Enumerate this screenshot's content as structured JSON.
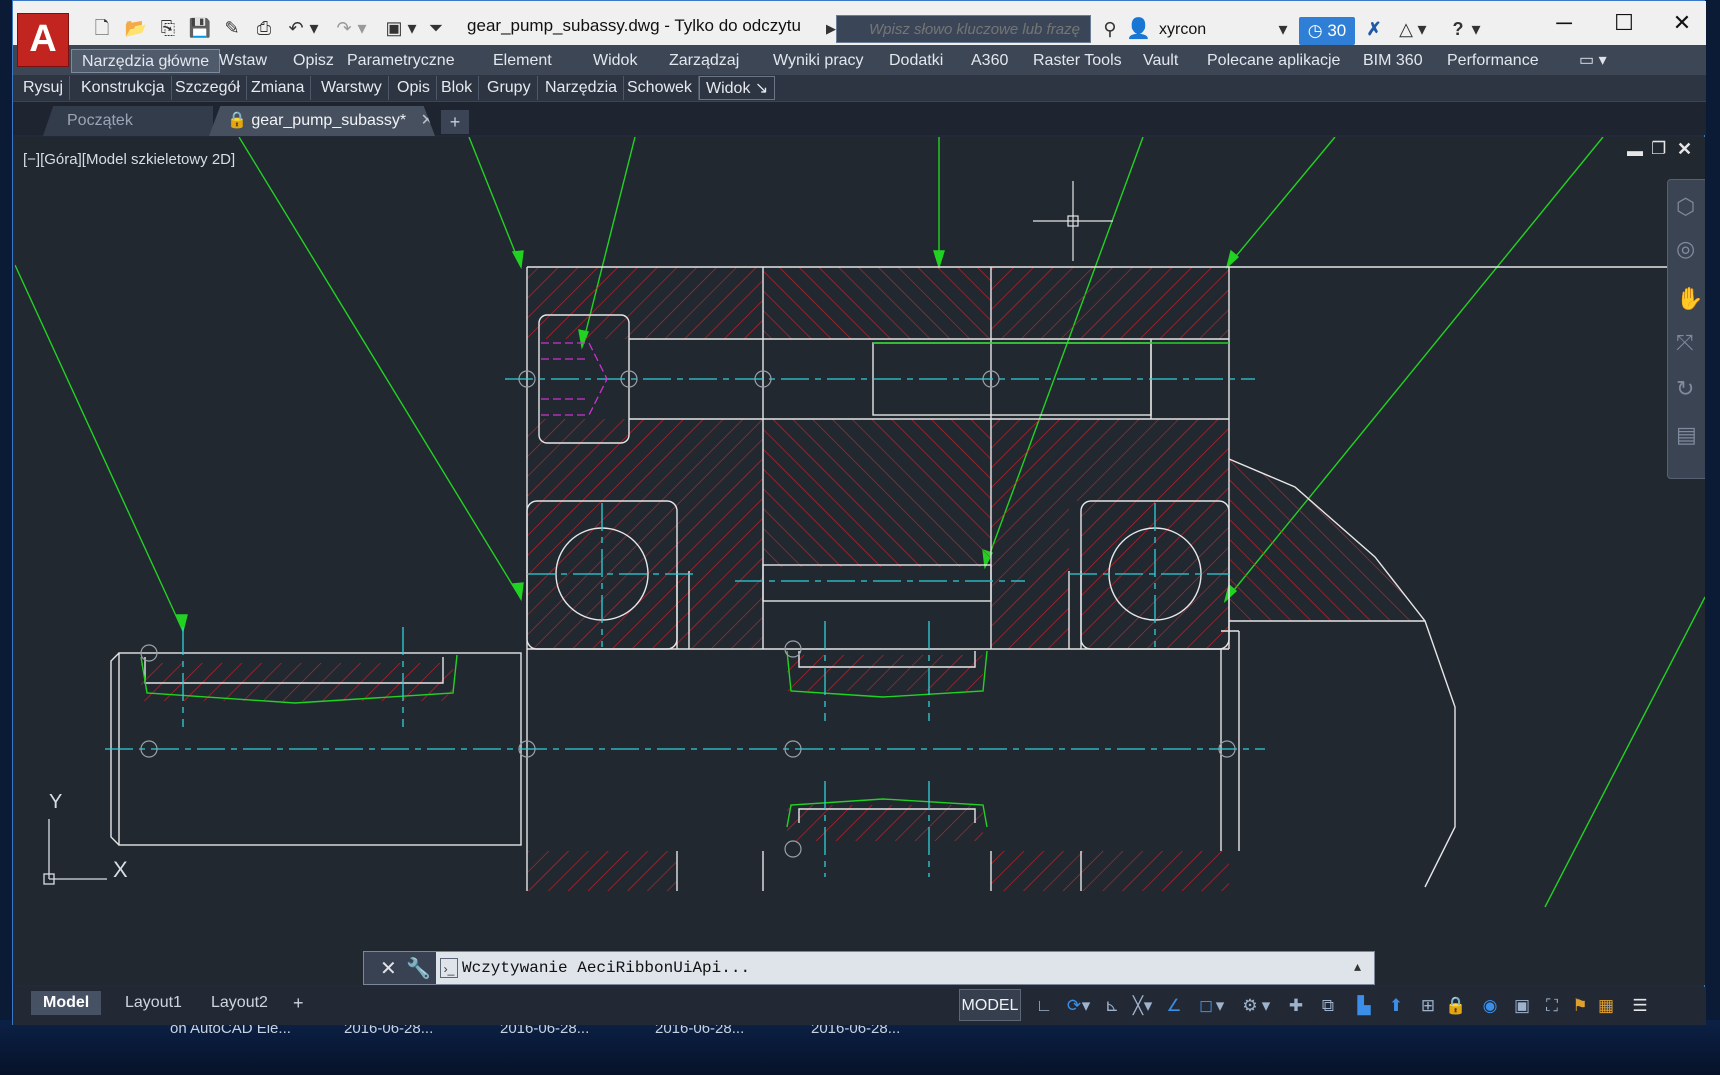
{
  "app": {
    "logo_letter": "A",
    "document_title": "gear_pump_subassy.dwg - Tylko do odczytu",
    "search_placeholder": "Wpisz słowo kluczowe lub frazę",
    "user_name": "xyrcon",
    "timer_count": "30"
  },
  "ribbon_tabs": [
    "Narzędzia główne",
    "Wstaw",
    "Opisz",
    "Parametryczne",
    "Element",
    "Widok",
    "Zarządzaj",
    "Wyniki pracy",
    "Dodatki",
    "A360",
    "Raster Tools",
    "Vault",
    "Polecane aplikacje",
    "BIM 360",
    "Performance"
  ],
  "ribbon_active": "Narzędzia główne",
  "panels": [
    "Rysuj",
    "Konstrukcja",
    "Szczegół",
    "Zmiana",
    "Warstwy",
    "Opis",
    "Blok",
    "Grupy",
    "Narzędzia",
    "Schowek",
    "Widok ↘"
  ],
  "file_tabs": [
    {
      "label": "Początek"
    },
    {
      "label": "gear_pump_subassy*"
    }
  ],
  "viewport": {
    "label": "[−][Góra][Model szkieletowy 2D]",
    "ucs_x": "X",
    "ucs_y": "Y"
  },
  "command_line": {
    "text": "Wczytywanie AeciRibbonUiApi..."
  },
  "layout_tabs": [
    "Model",
    "Layout1",
    "Layout2"
  ],
  "status": {
    "model_label": "MODEL"
  },
  "desktop": {
    "items": [
      "on AutoCAD Ele...",
      "2016-06-28...",
      "2016-06-28...",
      "2016-06-28...",
      "2016-06-28..."
    ]
  },
  "colors": {
    "hatch": "#d2222a",
    "centerline": "#2fd0d8",
    "leader": "#22d222",
    "outline": "#e6e6e6",
    "magenta": "#d030d0"
  }
}
